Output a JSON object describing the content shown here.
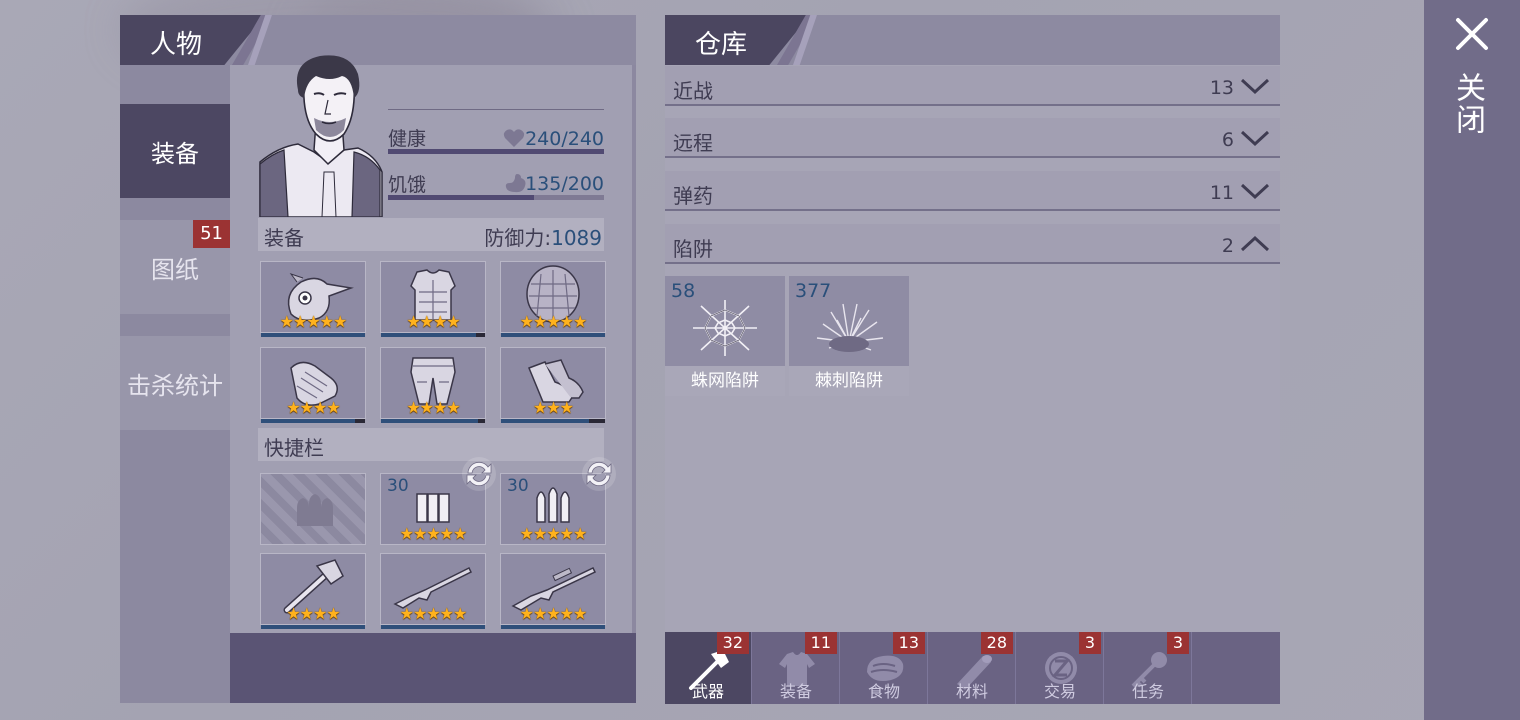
{
  "character": {
    "title": "人物",
    "side_tabs": [
      {
        "label": "装备",
        "badge": ""
      },
      {
        "label": "图纸",
        "badge": "51"
      },
      {
        "label": "击杀统计",
        "badge": ""
      }
    ],
    "stats": {
      "health": {
        "label": "健康",
        "value": "240/240",
        "fraction": 1.0,
        "icon": "heart-icon"
      },
      "hunger": {
        "label": "饥饿",
        "value": "135/200",
        "fraction": 0.675,
        "icon": "stomach-icon"
      }
    },
    "equipment": {
      "title": "装备",
      "defense_label": "防御力:",
      "defense_value": "1089",
      "slots": [
        {
          "item": "bird-mask-icon",
          "stars": "★★★★★",
          "durability": 1.0
        },
        {
          "item": "armor-vest-icon",
          "stars": "★★★★",
          "durability": 0.95
        },
        {
          "item": "turtle-shell-icon",
          "stars": "★★★★★",
          "durability": 1.0
        },
        {
          "item": "gloves-icon",
          "stars": "★★★★",
          "durability": 0.9
        },
        {
          "item": "armor-pants-icon",
          "stars": "★★★★",
          "durability": 0.95
        },
        {
          "item": "boots-icon",
          "stars": "★★★",
          "durability": 0.85
        }
      ]
    },
    "hotbar": {
      "title": "快捷栏",
      "slots": [
        {
          "item": "empty-ammo-slot-icon",
          "count": "",
          "stars": ""
        },
        {
          "item": "shotgun-shells-icon",
          "count": "30",
          "stars": "★★★★★"
        },
        {
          "item": "rifle-bullets-icon",
          "count": "30",
          "stars": "★★★★★"
        },
        {
          "item": "hatchet-icon",
          "count": "",
          "stars": "★★★★"
        },
        {
          "item": "shotgun-icon",
          "count": "",
          "stars": "★★★★★"
        },
        {
          "item": "rifle-icon",
          "count": "",
          "stars": "★★★★★"
        }
      ]
    }
  },
  "warehouse": {
    "title": "仓库",
    "categories": [
      {
        "name": "近战",
        "count": "13",
        "expanded": false
      },
      {
        "name": "远程",
        "count": "6",
        "expanded": false
      },
      {
        "name": "弹药",
        "count": "11",
        "expanded": false
      },
      {
        "name": "陷阱",
        "count": "2",
        "expanded": true
      }
    ],
    "items": [
      {
        "name": "蛛网陷阱",
        "count": "58",
        "icon": "spider-web-trap-icon"
      },
      {
        "name": "棘刺陷阱",
        "count": "377",
        "icon": "thorn-trap-icon"
      }
    ],
    "bottom_tabs": [
      {
        "label": "武器",
        "badge": "32",
        "icon": "axe-icon",
        "active": true
      },
      {
        "label": "装备",
        "badge": "11",
        "icon": "shirt-icon",
        "active": false
      },
      {
        "label": "食物",
        "badge": "13",
        "icon": "meat-icon",
        "active": false
      },
      {
        "label": "材料",
        "badge": "28",
        "icon": "log-icon",
        "active": false
      },
      {
        "label": "交易",
        "badge": "3",
        "icon": "coin-icon",
        "active": false
      },
      {
        "label": "任务",
        "badge": "3",
        "icon": "key-icon",
        "active": false
      }
    ]
  },
  "close": {
    "label": "关闭"
  }
}
